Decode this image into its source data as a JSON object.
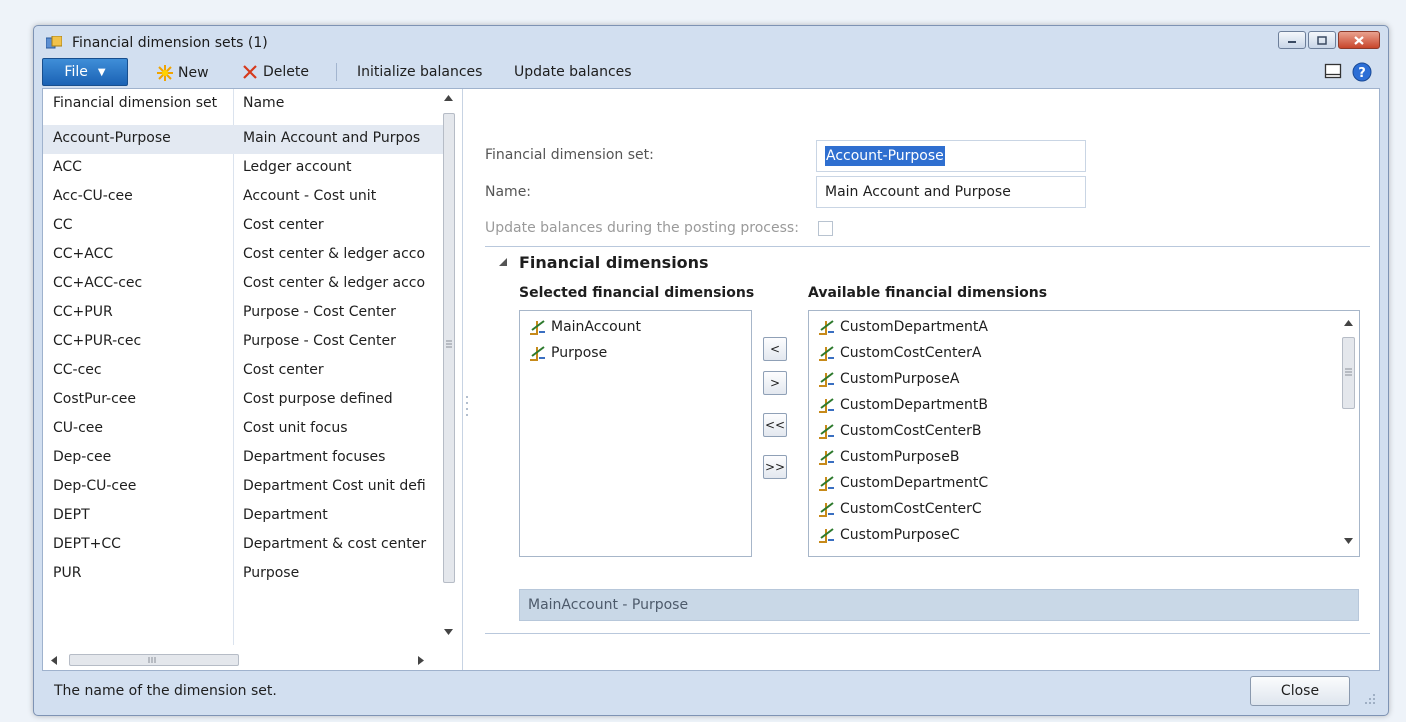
{
  "window": {
    "title": "Financial dimension sets (1)",
    "controls": [
      "minimize",
      "maximize",
      "close"
    ]
  },
  "toolbar": {
    "file_label": "File",
    "new_label": "New",
    "delete_label": "Delete",
    "initialize_label": "Initialize balances",
    "update_label": "Update balances"
  },
  "list": {
    "headers": [
      "Financial dimension set",
      "Name"
    ],
    "rows": [
      {
        "set": "Account-Purpose",
        "name": "Main Account and Purpos"
      },
      {
        "set": "ACC",
        "name": "Ledger account"
      },
      {
        "set": "Acc-CU-cee",
        "name": "Account - Cost unit"
      },
      {
        "set": "CC",
        "name": "Cost center"
      },
      {
        "set": "CC+ACC",
        "name": "Cost center & ledger acco"
      },
      {
        "set": "CC+ACC-cec",
        "name": "Cost center & ledger acco"
      },
      {
        "set": "CC+PUR",
        "name": "Purpose - Cost Center"
      },
      {
        "set": "CC+PUR-cec",
        "name": "Purpose - Cost Center"
      },
      {
        "set": "CC-cec",
        "name": "Cost center"
      },
      {
        "set": "CostPur-cee",
        "name": "Cost purpose defined"
      },
      {
        "set": "CU-cee",
        "name": "Cost unit focus"
      },
      {
        "set": "Dep-cee",
        "name": "Department focuses"
      },
      {
        "set": "Dep-CU-cee",
        "name": "Department Cost unit defi"
      },
      {
        "set": "DEPT",
        "name": "Department"
      },
      {
        "set": "DEPT+CC",
        "name": "Department & cost center"
      },
      {
        "set": "PUR",
        "name": "Purpose"
      }
    ]
  },
  "form": {
    "set_label": "Financial dimension set:",
    "set_value": "Account-Purpose",
    "name_label": "Name:",
    "name_value": "Main Account and Purpose",
    "update_label": "Update balances during the posting process:",
    "update_checked": false,
    "group_title": "Financial dimensions",
    "selected_title": "Selected financial dimensions",
    "available_title": "Available financial dimensions",
    "selected": [
      "MainAccount",
      "Purpose"
    ],
    "available": [
      "CustomDepartmentA",
      "CustomCostCenterA",
      "CustomPurposeA",
      "CustomDepartmentB",
      "CustomCostCenterB",
      "CustomPurposeB",
      "CustomDepartmentC",
      "CustomCostCenterC",
      "CustomPurposeC"
    ],
    "move_buttons": [
      "<",
      ">",
      "<<",
      ">>"
    ],
    "preview": "MainAccount - Purpose"
  },
  "status": {
    "text": "The name of the dimension set.",
    "close_label": "Close"
  },
  "colors": {
    "file_button": "#1b62b4",
    "selection_highlight": "#2f6fd0",
    "window_frame": "#d2dff0",
    "close_red": "#c8452b"
  }
}
